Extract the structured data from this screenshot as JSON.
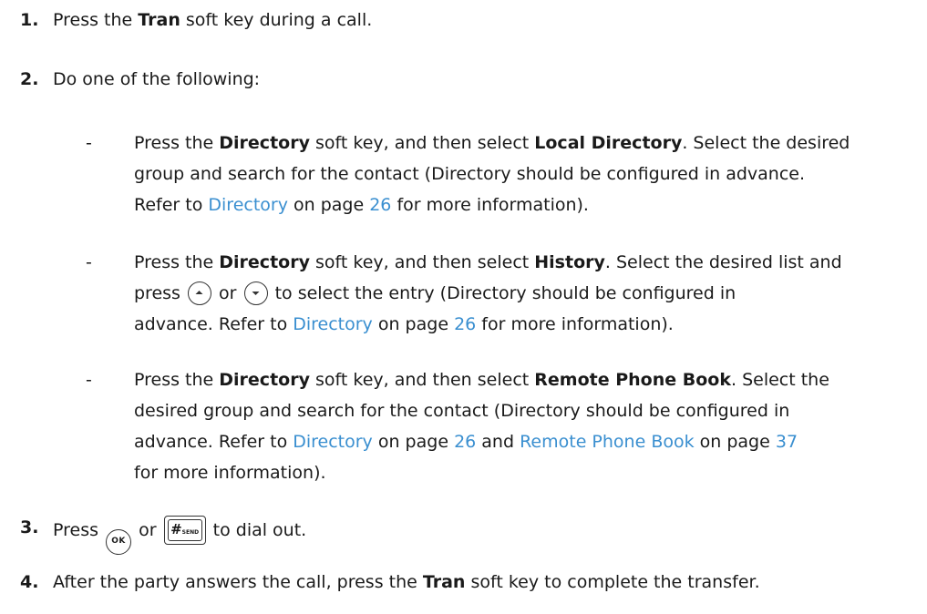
{
  "steps": [
    {
      "num": "1.",
      "pre": "Press the ",
      "key": "Tran",
      "post": " soft key during a call."
    },
    {
      "num": "2.",
      "text": "Do one of the following:"
    },
    {
      "num": "3.",
      "pre": "Press",
      "or": "or",
      "post": "to dial out.",
      "ok_label": "OK",
      "send_hash": "#",
      "send_label": "SEND"
    },
    {
      "num": "4.",
      "pre": "After the party answers the call, press the ",
      "key": "Tran",
      "post": " soft key to complete the transfer."
    }
  ],
  "options": [
    {
      "dash": "-",
      "lines": [
        {
          "p1": "Press the ",
          "b1": "Directory",
          "p2": " soft key, and then select ",
          "b2": "Local Directory",
          "p3": ". Select the desired"
        },
        {
          "t": "group and search for the contact (Directory should be configured in advance."
        },
        {
          "p1": "Refer to ",
          "link": "Directory",
          "p2": " on page ",
          "page": "26",
          "p3": " for more information)."
        }
      ]
    },
    {
      "dash": "-",
      "lines": [
        {
          "p1": "Press the ",
          "b1": "Directory",
          "p2": " soft key, and then select ",
          "b2": "History",
          "p3": ". Select the desired list and"
        },
        {
          "p1": "press",
          "or": "or",
          "p2": "to select the entry (Directory should be configured in"
        },
        {
          "p1": "advance. Refer to ",
          "link": "Directory",
          "p2": " on page ",
          "page": "26",
          "p3": " for more information)."
        }
      ]
    },
    {
      "dash": "-",
      "lines": [
        {
          "p1": "Press the ",
          "b1": "Directory",
          "p2": " soft key, and then select ",
          "b2": "Remote Phone Book",
          "p3": ". Select the"
        },
        {
          "t": "desired group and search for the contact (Directory should be configured in"
        },
        {
          "p1": "advance. Refer to ",
          "link": "Directory",
          "p2": " on page ",
          "page": "26",
          "p3": " and ",
          "link2": "Remote Phone Book",
          "p4": " on page ",
          "page2": "37"
        },
        {
          "t": "for more information)."
        }
      ]
    }
  ]
}
